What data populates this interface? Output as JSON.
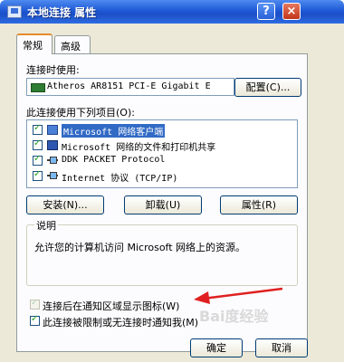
{
  "window": {
    "title": "本地连接 属性",
    "help_glyph": "?",
    "close_glyph": "×"
  },
  "tabs": [
    {
      "label": "常规",
      "active": true
    },
    {
      "label": "高级",
      "active": false
    }
  ],
  "connect_using": {
    "label": "连接时使用:",
    "adapter": "Atheros AR8151 PCI-E Gigabit E",
    "configure_button": "配置(C)..."
  },
  "items_section": {
    "label": "此连接使用下列项目(O):",
    "items": [
      {
        "label": "Microsoft 网络客户端",
        "checked": true,
        "selected": true,
        "icon": "network-client-icon"
      },
      {
        "label": "Microsoft 网络的文件和打印机共享",
        "checked": true,
        "selected": false,
        "icon": "file-share-icon"
      },
      {
        "label": "DDK PACKET Protocol",
        "checked": true,
        "selected": false,
        "icon": "protocol-icon"
      },
      {
        "label": "Internet 协议 (TCP/IP)",
        "checked": true,
        "selected": false,
        "icon": "protocol-icon"
      }
    ]
  },
  "actions": {
    "install": "安装(N)...",
    "uninstall": "卸载(U)",
    "properties": "属性(R)"
  },
  "description": {
    "title": "说明",
    "text": "允许您的计算机访问 Microsoft 网络上的资源。"
  },
  "options": [
    {
      "label": "连接后在通知区域显示图标(W)",
      "checked": true,
      "enabled": false
    },
    {
      "label": "此连接被限制或无连接时通知我(M)",
      "checked": true,
      "enabled": true
    }
  ],
  "footer": {
    "ok": "确定",
    "cancel": "取消"
  },
  "watermark": "Bai度经验",
  "colors": {
    "accent": "#1f59d6",
    "arrow": "#e02020",
    "selection": "#316ac5"
  }
}
